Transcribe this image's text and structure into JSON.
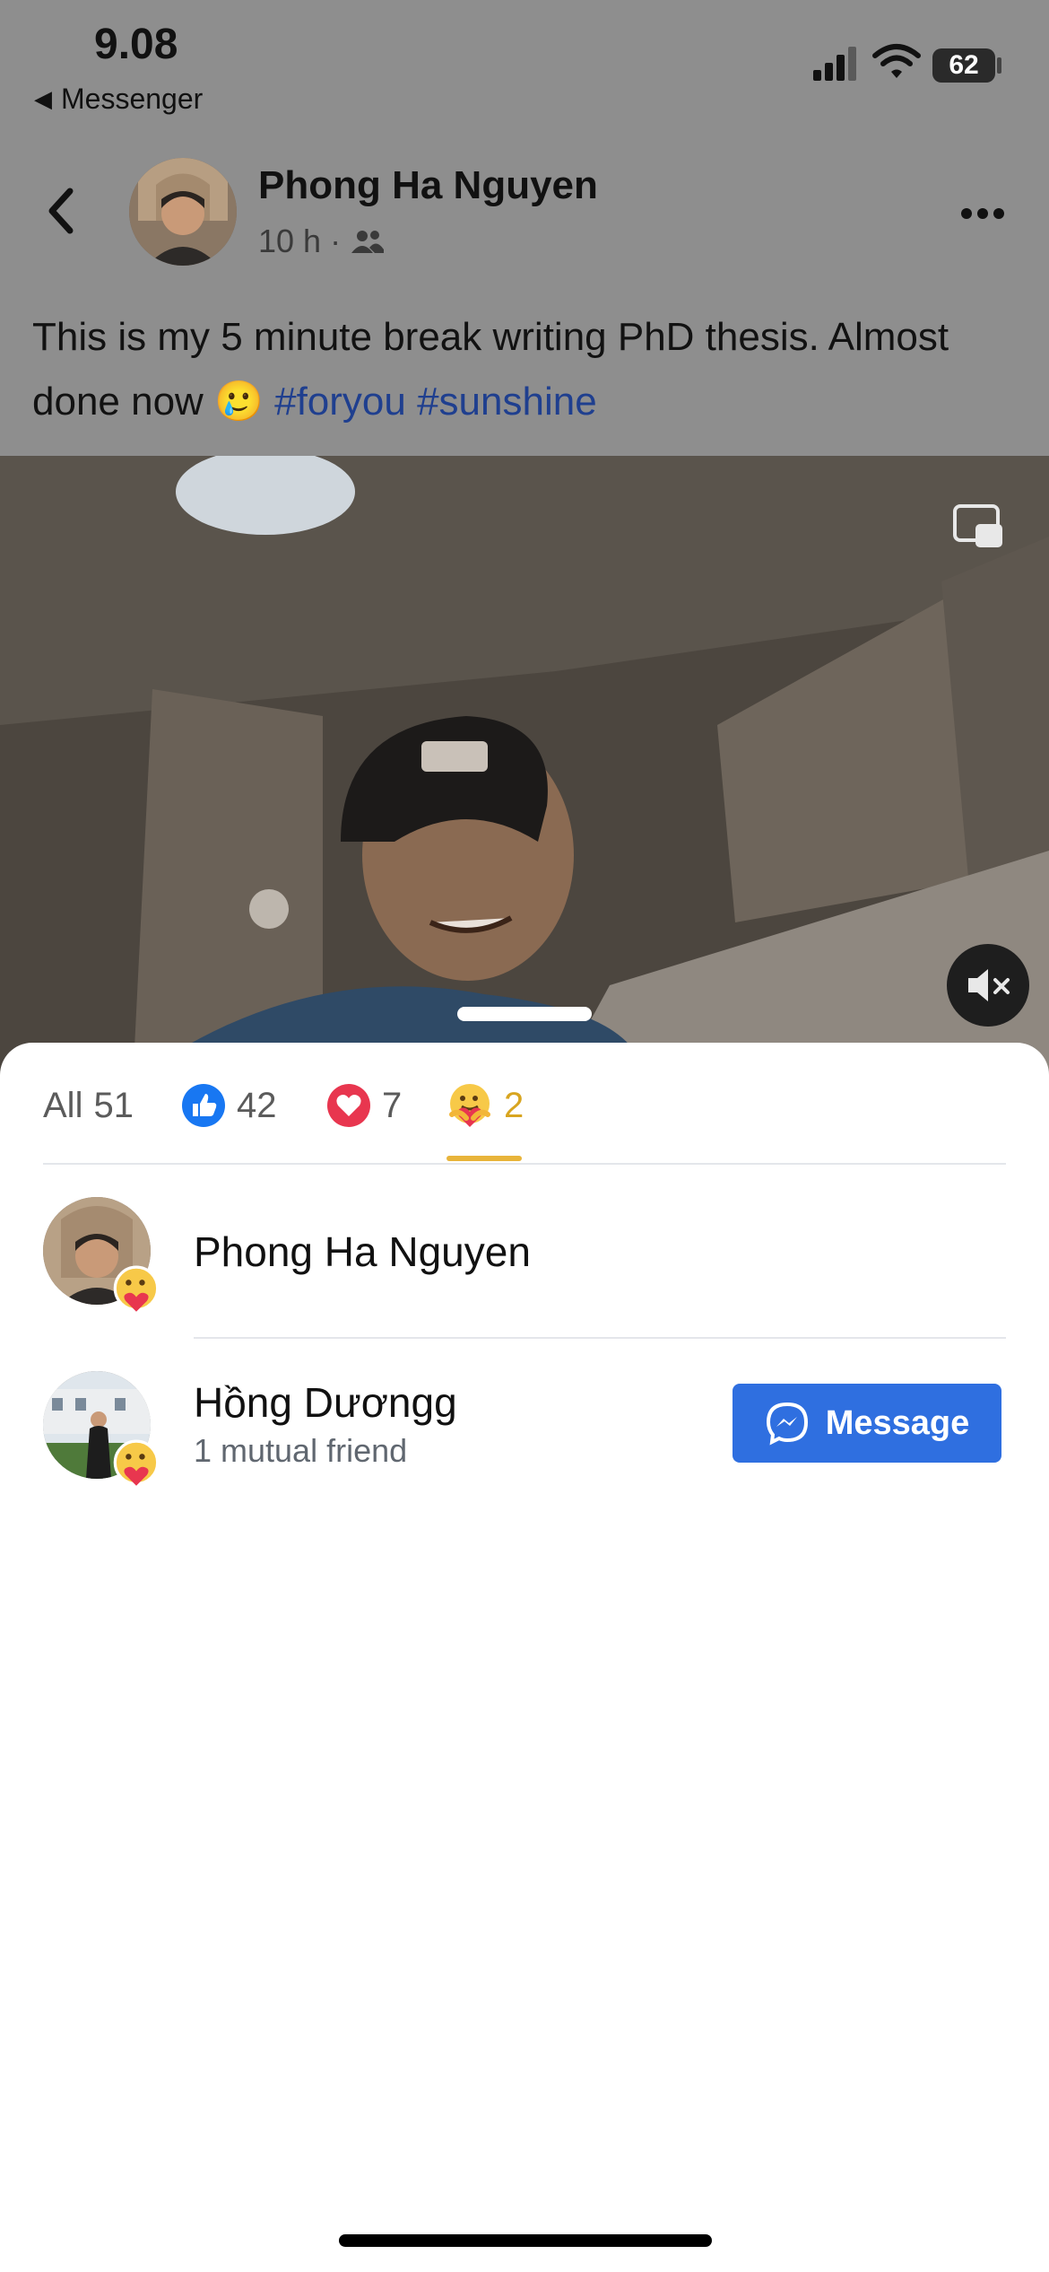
{
  "status_bar": {
    "time": "9.08",
    "back_app": "Messenger",
    "battery": "62"
  },
  "post": {
    "author": "Phong Ha Nguyen",
    "time_ago": "10 h",
    "dot": "·",
    "text_before": "This is my 5 minute break writing PhD thesis. Almost done now",
    "emoji": "🥲",
    "hashtags": "#foryou #sunshine"
  },
  "reactions": {
    "tabs": [
      {
        "label": "All",
        "count": "51"
      },
      {
        "label": "like-icon",
        "count": "42"
      },
      {
        "label": "love-icon",
        "count": "7"
      },
      {
        "label": "care-icon",
        "count": "2"
      }
    ],
    "active_tab_index": 3,
    "people": [
      {
        "name": "Phong Ha Nguyen",
        "subtitle": ""
      },
      {
        "name": "Hồng Dươngg",
        "subtitle": "1 mutual friend",
        "action": "Message"
      }
    ]
  },
  "colors": {
    "accent_active": "#e8b43a",
    "message_button": "#2f6fe0",
    "hashtag": "#1f3f8f"
  }
}
